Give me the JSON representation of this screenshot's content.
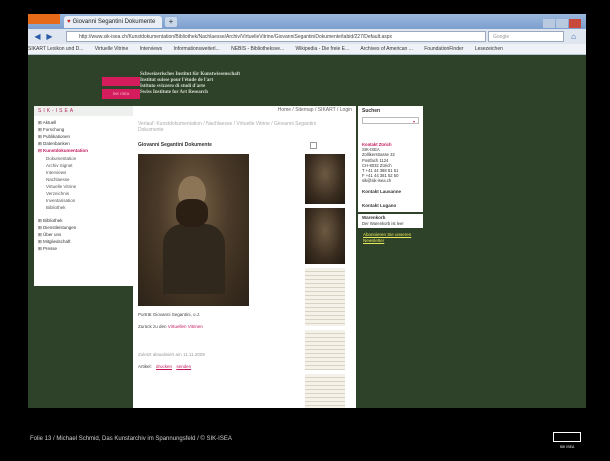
{
  "browser": {
    "menu_button": "Firefox",
    "tab_title": "Giovanni Segantini Dokumente",
    "new_tab": "+",
    "url": "http://www.sik-isea.ch/Kunstdokumentation/Bibliothek/Nachlaesse/Archiv/VirtuelleVitrine/GiovanniSegantiniDokumente/tabid/227/Default.aspx",
    "search_placeholder": "Google",
    "bookmarks": [
      "SIKART Lexikon und D...",
      "Virtuelle Vitrine",
      "Interviews",
      "Informationsweiterl...",
      "NEBIS - Bibliotheksve...",
      "Wikipedia - Die freie E...",
      "Archives of American ...",
      "FoundationFinder",
      "Lesezeichen"
    ]
  },
  "institute": {
    "logo_text": "SIK ISEA",
    "names": [
      "Schweizerisches Institut für Kunstwissenschaft",
      "Institut suisse pour l'étude de l'art",
      "Istituto svizzero di studi d'arte",
      "Swiss Institute for Art Research"
    ]
  },
  "leftnav": {
    "header": "SIK-ISEA",
    "items": [
      {
        "label": "⊞ Aktuell"
      },
      {
        "label": "⊞ Forschung"
      },
      {
        "label": "⊞ Publikationen"
      },
      {
        "label": "⊞ Datenbanken"
      },
      {
        "label": "⊟ Kunstdokumentation"
      }
    ],
    "subitems": [
      "Dokumentation",
      "Archiv Signet",
      "Interviews",
      "Nachlaesse",
      "Virtuelle Vitrine",
      "Verzeichnis",
      "Inventarisation",
      "Bibliothek"
    ],
    "items2": [
      "⊞ Bibliothek",
      "⊞ Dienstleistungen",
      "⊞ Über uns",
      "⊞ Mitgliedschaft",
      "⊞ Presse"
    ]
  },
  "center": {
    "top_links": "Home / Sitemap / SIKART / Login",
    "path": "Verlauf: Kunstdokumentation / Nachlaesse / Virtuelle Vitrine / Giovanni Segantini Dokumente",
    "title": "Giovanni Segantini Dokumente",
    "caption": "Porträt Giovanni Segantini, o.J.",
    "back_prefix": "Zurück zu den",
    "back_link": "Virtuellen Vitrinen",
    "updated": "Zuletzt aktualisiert am 11.11.2009",
    "actions_label": "Artikel:",
    "action_print": "drucken",
    "action_send": "senden"
  },
  "right": {
    "title": "Suchen",
    "select_arrow": "▾",
    "contact_heading": "Kontakt Zürich",
    "contact_lines": [
      "SIK-ISEA",
      "Zollikerstrasse 32",
      "Postfach 1124",
      "CH-8032 Zürich",
      "T +41 44 388 51 51",
      "F +41 44 381 52 50",
      "sik@sik-isea.ch"
    ],
    "box1": "Kontakt Lausanne",
    "box2": "Kontakt Lugano",
    "wk_heading": "Warenkorb",
    "wk_text": "Der Warenkorb ist leer",
    "newsletter": [
      "Abonnieren Sie unseren",
      "Newsletter"
    ]
  },
  "footer": {
    "text": "Folie 13 / Michael Schmid, Das Kunstarchiv im Spannungsfeld / © SIK-ISEA",
    "logo_text": "SIK ISEA"
  },
  "colors": {
    "accent": "#d51d5e",
    "page_bg": "#2e4229",
    "newsletter": "#e7e85a"
  }
}
